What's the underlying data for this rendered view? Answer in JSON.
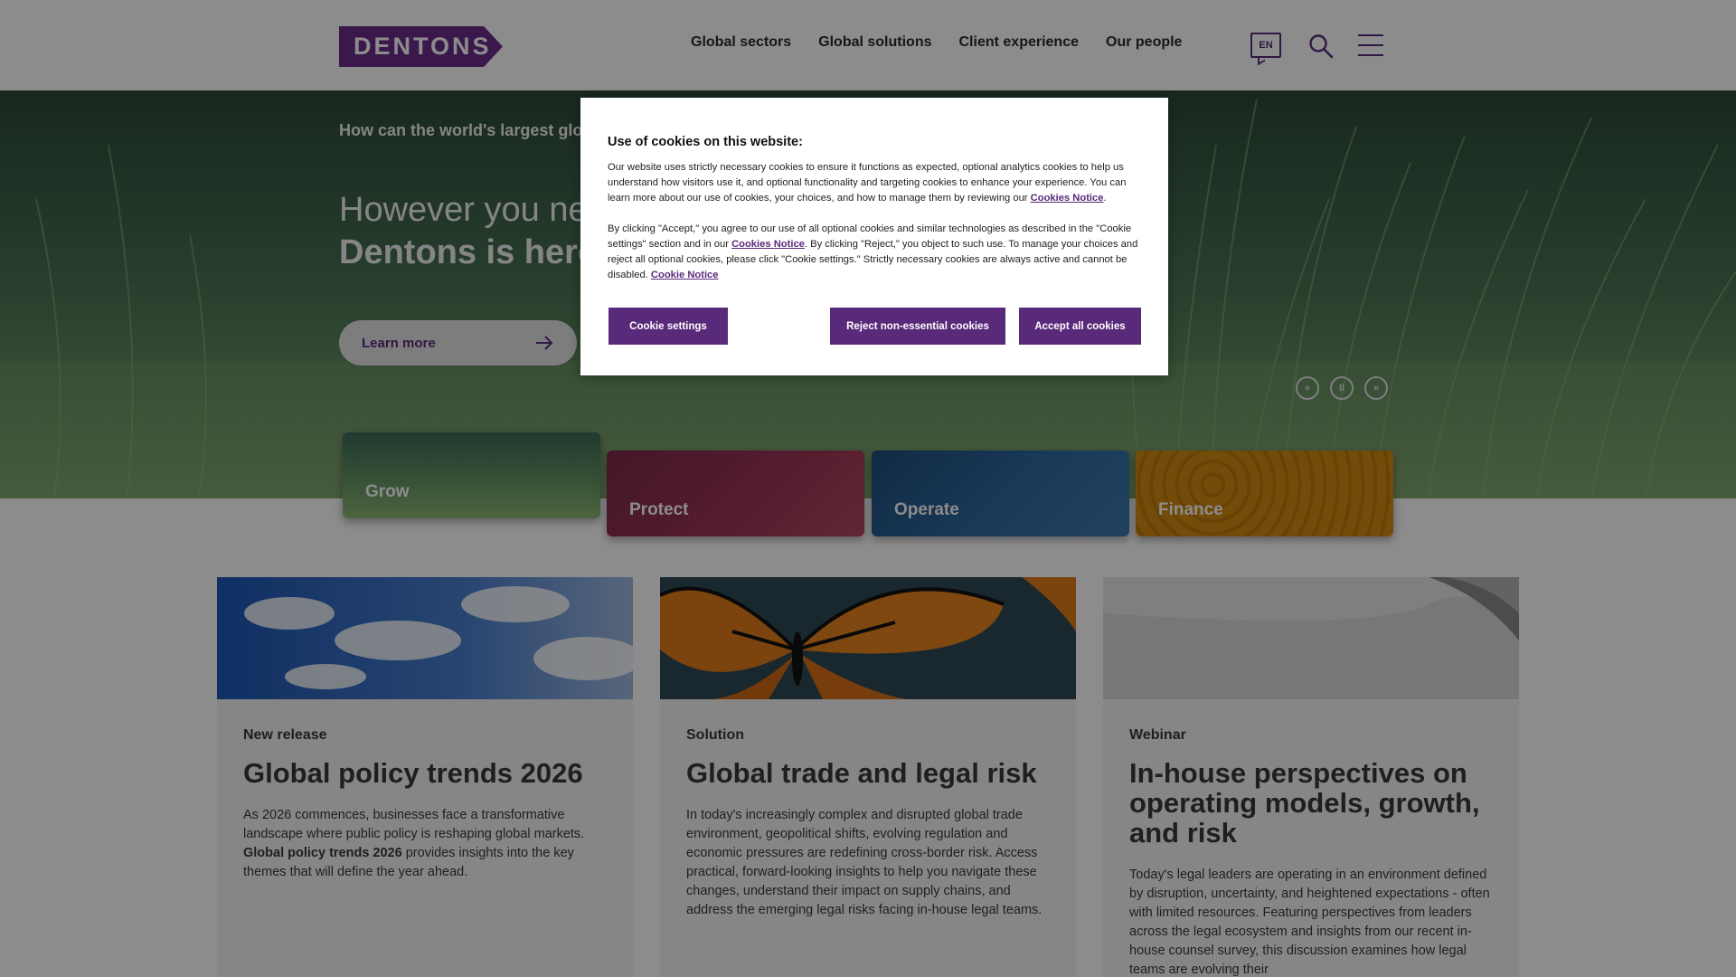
{
  "header": {
    "logo_text": "DENTONS",
    "nav": [
      "Global sectors",
      "Global solutions",
      "Client experience",
      "Our people"
    ],
    "language": "EN",
    "colors": {
      "brand": "#5a2a7a"
    }
  },
  "hero": {
    "question": "How can the world's largest glo",
    "line1": "However you nee",
    "line2": "Dentons is here",
    "cta_label": "Learn more",
    "controls": {
      "prev": "«",
      "pause": "II",
      "next": "»"
    }
  },
  "tiles": [
    "Grow",
    "Protect",
    "Operate",
    "Finance"
  ],
  "cards": [
    {
      "type": "New release",
      "title": "Global policy trends 2026",
      "body_pre": "As 2026 commences, businesses face a transformative landscape where public policy is reshaping global markets. ",
      "body_bold": "Global policy trends 2026",
      "body_post": " provides insights into the key themes that will define the year ahead."
    },
    {
      "type": "Solution",
      "title": "Global trade and legal risk",
      "body": "In today's increasingly complex and disrupted global trade environment, geopolitical shifts, evolving regulation and economic pressures are redefining cross-border risk. Access practical, forward-looking insights to help you navigate these changes, understand their impact on supply chains, and address the emerging legal risks facing in-house legal teams."
    },
    {
      "type": "Webinar",
      "title": "In-house perspectives on operating models, growth, and risk",
      "body": "Today's legal leaders are operating in an environment defined by disruption, uncertainty, and heightened expectations - often with limited resources. Featuring perspectives from leaders across the legal ecosystem and insights from our recent in-house counsel survey, this discussion examines how legal teams are evolving their"
    }
  ],
  "cookie": {
    "title": "Use of cookies on this website:",
    "p1": "Our website uses strictly necessary cookies to ensure it functions as expected, optional analytics cookies to help us understand how visitors use it, and optional functionality and targeting cookies to enhance your experience. You can learn more about our use of cookies, your choices, and how to manage them by reviewing our ",
    "p1_link": "Cookies Notice",
    "p1_end": ".",
    "p2a": "By clicking \"Accept,\" you agree to our use of all optional cookies and similar technologies as described in the \"Cookie settings\" section and in our ",
    "p2_link": "Cookies Notice",
    "p2b": ". By clicking \"Reject,\" you object to such use. To manage your choices and reject all optional cookies, please click \"Cookie settings.\" Strictly necessary cookies are always active and cannot be disabled. ",
    "p2_link2": "Cookie Notice",
    "btn_settings": "Cookie settings",
    "btn_reject": "Reject non-essential cookies",
    "btn_accept": "Accept all cookies"
  }
}
